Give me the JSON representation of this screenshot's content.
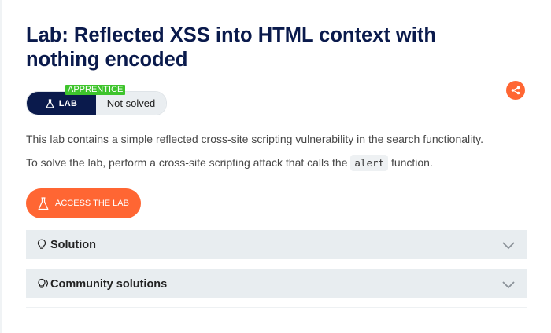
{
  "lab": {
    "title": "Lab: Reflected XSS into HTML context with nothing encoded",
    "level": "APPRENTICE",
    "badge_label": "LAB",
    "status": "Not solved",
    "description_1": "This lab contains a simple reflected cross-site scripting vulnerability in the search functionality.",
    "description_2_before": "To solve the lab, perform a cross-site scripting attack that calls the",
    "description_2_code": "alert",
    "description_2_after": "function.",
    "access_button": "ACCESS THE LAB"
  },
  "accordions": [
    {
      "label": "Solution",
      "icon": "lightbulb-icon"
    },
    {
      "label": "Community solutions",
      "icon": "community-lightbulb-icon"
    }
  ],
  "colors": {
    "title": "#0a1a4c",
    "accent": "#ff6633",
    "level": "#3ec42c",
    "badge": "#0a1a4c",
    "panel": "#e8edf0"
  }
}
